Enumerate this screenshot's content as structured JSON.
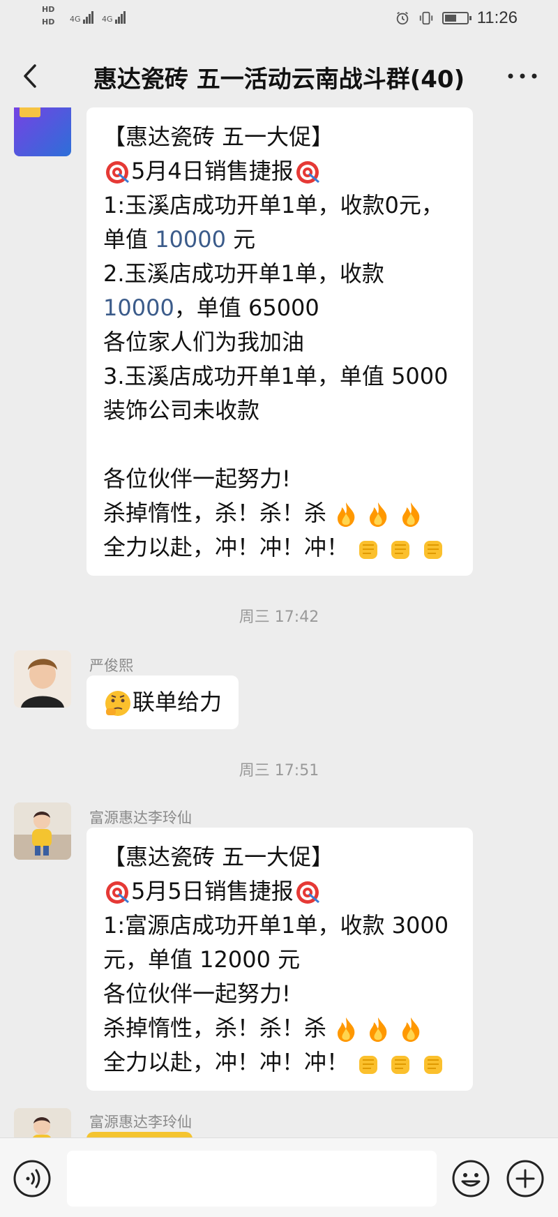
{
  "status_bar": {
    "hd1": "HD",
    "hd2": "HD",
    "net1": "4G",
    "net2": "4G",
    "time": "11:26",
    "icons": [
      "alarm-icon",
      "vibrate-icon",
      "battery-icon"
    ],
    "battery_level": 0.55
  },
  "header": {
    "title": "惠达瓷砖 五一活动云南战斗群(40)",
    "back_icon": "chevron-left-icon",
    "more_icon": "more-dots-icon"
  },
  "messages": [
    {
      "lines": [
        "【惠达瓷砖  五一大促】",
        "5月4日销售捷报",
        "1:玉溪店成功开单1单，收款0元，",
        "单值 10000 元",
        "2.玉溪店成功开单1单，收款",
        "10000，单值 65000",
        "各位家人们为我加油",
        "3.玉溪店成功开单1单，单值 5000",
        "装饰公司未收款",
        "",
        "各位伙伴一起努力!",
        "杀掉惰性，杀！杀！杀",
        "全力以赴，冲！冲！冲！"
      ],
      "line4_pre": "单值 ",
      "line4_num": "10000",
      "line4_post": " 元",
      "line6_num": "10000",
      "line6_post": "，单值 65000"
    },
    {
      "time": "周三 17:42",
      "sender": "严俊熙",
      "text": "联单给力"
    },
    {
      "time": "周三 17:51",
      "sender": "富源惠达李玲仙",
      "lines": [
        "【惠达瓷砖  五一大促】",
        "5月5日销售捷报",
        "1:富源店成功开单1单，收款 3000",
        "元，单值 12000 元",
        "各位伙伴一起努力!",
        "杀掉惰性，杀！杀！杀",
        "全力以赴，冲！冲！冲！"
      ]
    },
    {
      "sender": "富源惠达李玲仙"
    }
  ],
  "input_bar": {
    "placeholder": "",
    "icons": [
      "voice-icon",
      "emoji-icon",
      "plus-icon"
    ]
  },
  "colors": {
    "background": "#ededed",
    "bubble": "#ffffff",
    "number_link": "#3b5b8a",
    "sender_name": "#8a8a8a"
  }
}
